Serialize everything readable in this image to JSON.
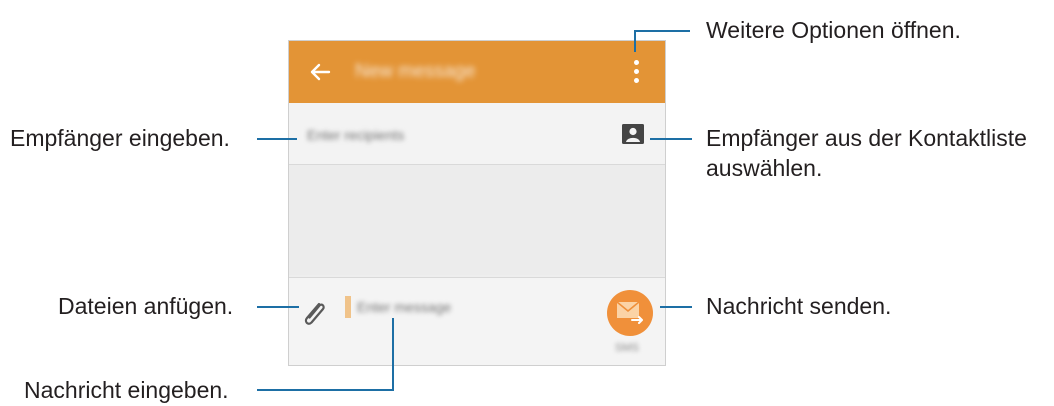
{
  "app_bar": {
    "title": "New message",
    "background": "#e39436",
    "back_icon": "arrow-left-icon",
    "more_icon": "more-vertical-icon"
  },
  "recipient": {
    "placeholder": "Enter recipients",
    "contacts_icon": "contact-card-icon"
  },
  "composer": {
    "attach_icon": "paperclip-icon",
    "placeholder": "Enter message",
    "send_icon": "envelope-send-icon",
    "send_caption": "SMS",
    "send_color": "#f0903a"
  },
  "callouts": {
    "more_options": "Weitere Optionen öffnen.",
    "enter_recipient": "Empfänger eingeben.",
    "from_contacts_line1": "Empfänger aus der Kontaktliste",
    "from_contacts_line2": "auswählen.",
    "attach_files": "Dateien anfügen.",
    "send_message": "Nachricht senden.",
    "enter_message": "Nachricht eingeben."
  },
  "colors": {
    "callout_line": "#1d6fa5",
    "text": "#231f20"
  }
}
